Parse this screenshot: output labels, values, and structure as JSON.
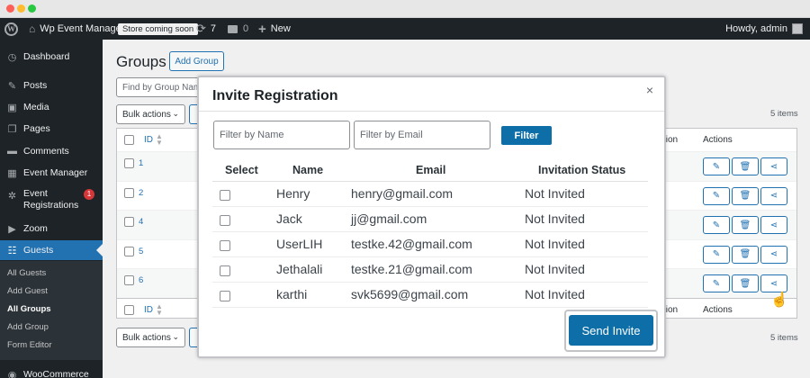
{
  "admin_bar": {
    "site_name": "Wp Event Manager",
    "coming_soon": "Store coming soon",
    "updates_count": "7",
    "comments_count": "0",
    "new_label": "New",
    "howdy": "Howdy, admin"
  },
  "sidebar": {
    "items": [
      {
        "label": "Dashboard",
        "icon": "dashboard-icon"
      },
      {
        "label": "Posts",
        "icon": "pin-icon"
      },
      {
        "label": "Media",
        "icon": "media-icon"
      },
      {
        "label": "Pages",
        "icon": "pages-icon"
      },
      {
        "label": "Comments",
        "icon": "comment-icon"
      },
      {
        "label": "Event Manager",
        "icon": "calendar-icon"
      },
      {
        "label": "Event",
        "label2": "Registrations",
        "badge": "1",
        "icon": "registrations-icon"
      },
      {
        "label": "Zoom",
        "icon": "video-icon"
      },
      {
        "label": "Guests",
        "icon": "guests-icon"
      }
    ],
    "submenu": [
      "All Guests",
      "Add Guest",
      "All Groups",
      "Add Group",
      "Form Editor"
    ],
    "woocommerce": "WooCommerce"
  },
  "page": {
    "title": "Groups",
    "add_group": "Add Group",
    "search_placeholder": "Find by Group Nam",
    "bulk_actions": "Bulk actions",
    "items_count": "5 items",
    "col_id": "ID",
    "col_tion": "tion",
    "col_actions": "Actions",
    "rows": [
      "1",
      "2",
      "4",
      "5",
      "6"
    ]
  },
  "modal": {
    "title": "Invite Registration",
    "close": "×",
    "filter_name_placeholder": "Filter by Name",
    "filter_email_placeholder": "Filter by Email",
    "filter_button": "Filter",
    "columns": [
      "Select",
      "Name",
      "Email",
      "Invitation Status"
    ],
    "rows": [
      {
        "name": "Henry",
        "email": "henry@gmail.com",
        "status": "Not Invited"
      },
      {
        "name": "Jack",
        "email": "jj@gmail.com",
        "status": "Not Invited"
      },
      {
        "name": "UserLIH",
        "email": "testke.42@gmail.com",
        "status": "Not Invited"
      },
      {
        "name": "Jethalali",
        "email": "testke.21@gmail.com",
        "status": "Not Invited"
      },
      {
        "name": "karthi",
        "email": "svk5699@gmail.com",
        "status": "Not Invited"
      }
    ],
    "send_invite": "Send Invite"
  },
  "colors": {
    "admin_dark": "#1d2327",
    "wp_blue": "#2271b1",
    "button_blue": "#0e6fa8",
    "badge_red": "#d63638"
  }
}
